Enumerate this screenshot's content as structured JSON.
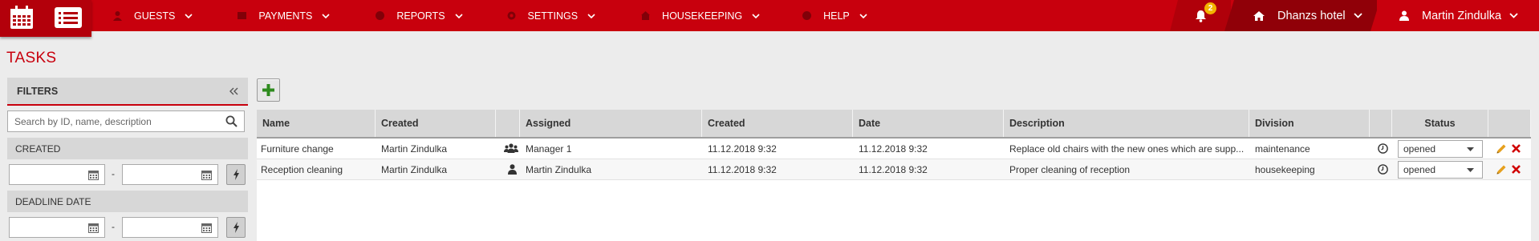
{
  "nav": {
    "items": [
      {
        "label": "GUESTS",
        "icon": "user-icon"
      },
      {
        "label": "PAYMENTS",
        "icon": "payment-icon"
      },
      {
        "label": "REPORTS",
        "icon": "reports-icon"
      },
      {
        "label": "SETTINGS",
        "icon": "gear-icon"
      },
      {
        "label": "HOUSEKEEPING",
        "icon": "housekeeping-icon"
      },
      {
        "label": "HELP",
        "icon": "help-icon"
      }
    ],
    "notifications_count": "2",
    "hotel_name": "Dhanzs hotel",
    "user_name": "Martin Zindulka"
  },
  "page": {
    "title": "TASKS"
  },
  "filters": {
    "title": "FILTERS",
    "search_placeholder": "Search by ID, name, description",
    "created_label": "CREATED",
    "deadline_label": "DEADLINE DATE",
    "range_separator": "-"
  },
  "table": {
    "columns": {
      "name": "Name",
      "created_by": "Created",
      "assigned": "Assigned",
      "created": "Created",
      "date": "Date",
      "description": "Description",
      "division": "Division",
      "status": "Status"
    },
    "rows": [
      {
        "name": "Furniture change",
        "created_by": "Martin Zindulka",
        "assignee_type": "group",
        "assigned": "Manager 1",
        "created": "11.12.2018 9:32",
        "date": "11.12.2018 9:32",
        "description": "Replace old chairs with the new ones which are supp...",
        "division": "maintenance",
        "status": "opened"
      },
      {
        "name": "Reception cleaning",
        "created_by": "Martin Zindulka",
        "assignee_type": "person",
        "assigned": "Martin Zindulka",
        "created": "11.12.2018 9:32",
        "date": "11.12.2018 9:32",
        "description": "Proper cleaning of reception",
        "division": "housekeeping",
        "status": "opened"
      }
    ]
  },
  "colors": {
    "brand_red": "#c8000d",
    "dark_red": "#900008",
    "badge_yellow": "#f3b400",
    "add_green": "#2e8b1e",
    "edit_orange": "#e6a01e",
    "delete_red": "#d00000"
  }
}
